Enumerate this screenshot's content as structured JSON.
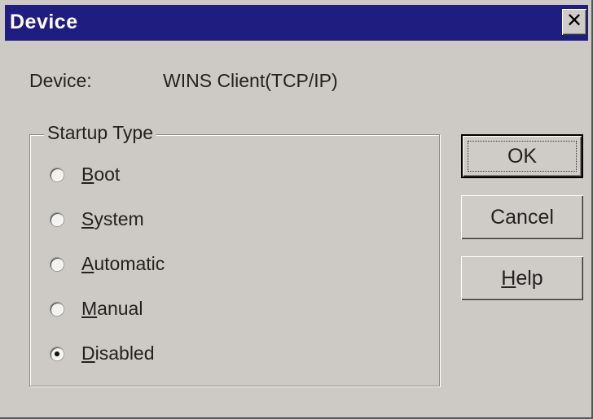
{
  "window": {
    "title": "Device",
    "close_glyph": "✕"
  },
  "device": {
    "label": "Device:",
    "value": "WINS Client(TCP/IP)"
  },
  "startup": {
    "legend": "Startup Type",
    "options": [
      {
        "prefix": "",
        "ul": "B",
        "rest": "oot",
        "selected": false
      },
      {
        "prefix": "",
        "ul": "S",
        "rest": "ystem",
        "selected": false
      },
      {
        "prefix": "",
        "ul": "A",
        "rest": "utomatic",
        "selected": false
      },
      {
        "prefix": "",
        "ul": "M",
        "rest": "anual",
        "selected": false
      },
      {
        "prefix": "",
        "ul": "D",
        "rest": "isabled",
        "selected": true
      }
    ]
  },
  "buttons": {
    "ok": "OK",
    "cancel": "Cancel",
    "help_ul": "H",
    "help_rest": "elp"
  },
  "colors": {
    "titlebar": "#1f1d80",
    "face": "#cdcac5"
  }
}
